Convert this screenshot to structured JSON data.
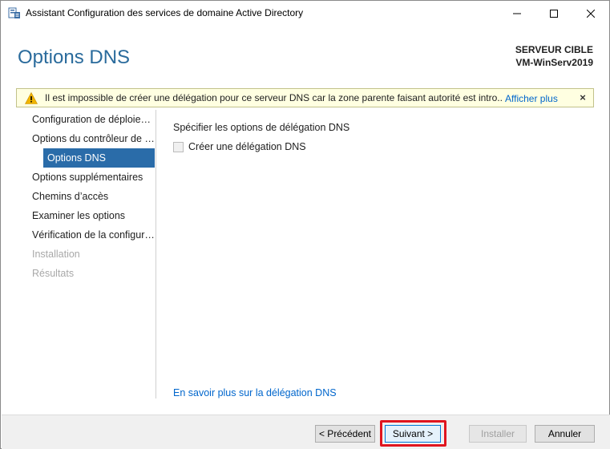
{
  "window": {
    "title": "Assistant Configuration des services de domaine Active Directory"
  },
  "header": {
    "page_title": "Options DNS",
    "target_label": "SERVEUR CIBLE",
    "target_name": "VM-WinServ2019"
  },
  "banner": {
    "message": "Il est impossible de créer une délégation pour ce serveur DNS car la zone parente faisant autorité est intro...",
    "link": "Afficher plus",
    "close": "×"
  },
  "nav": {
    "items": [
      {
        "label": "Configuration de déploiement",
        "state": "normal"
      },
      {
        "label": "Options du contrôleur de domaine",
        "state": "normal"
      },
      {
        "label": "Options DNS",
        "state": "selected"
      },
      {
        "label": "Options supplémentaires",
        "state": "normal"
      },
      {
        "label": "Chemins d’accès",
        "state": "normal"
      },
      {
        "label": "Examiner les options",
        "state": "normal"
      },
      {
        "label": "Vérification de la configuration requise",
        "state": "normal"
      },
      {
        "label": "Installation",
        "state": "disabled"
      },
      {
        "label": "Résultats",
        "state": "disabled"
      }
    ]
  },
  "main": {
    "section_label": "Spécifier les options de délégation DNS",
    "checkbox_label": "Créer une délégation DNS",
    "checkbox_checked": false,
    "help_link": "En savoir plus sur la délégation DNS"
  },
  "footer": {
    "prev": "< Précédent",
    "next": "Suivant >",
    "install": "Installer",
    "cancel": "Annuler"
  },
  "colors": {
    "accent": "#2a6ca9",
    "title": "#2a6b9c",
    "link": "#0066cc",
    "highlight": "#e0151f",
    "banner_bg": "#ffffe1"
  }
}
